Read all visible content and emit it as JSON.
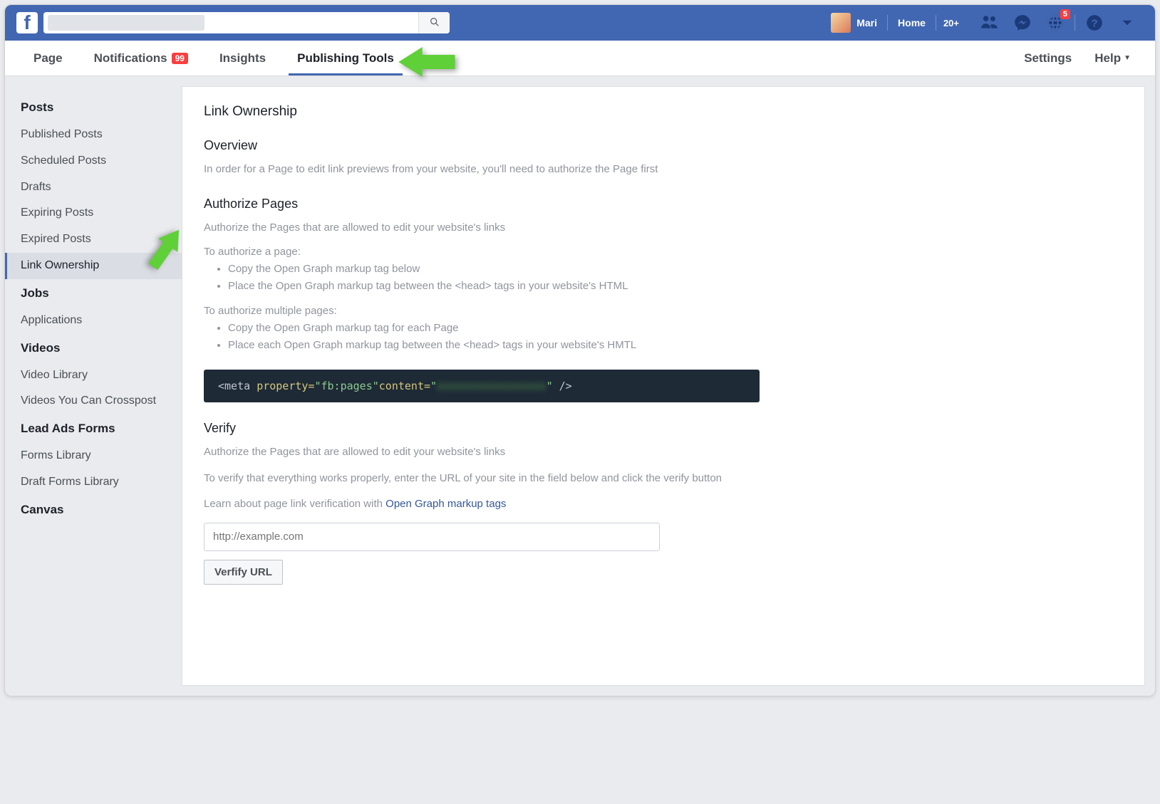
{
  "topbar": {
    "username": "Mari",
    "home_label": "Home",
    "notif_count": "20+",
    "globe_badge": "5"
  },
  "nav": {
    "tabs": [
      {
        "label": "Page"
      },
      {
        "label": "Notifications",
        "badge": "99"
      },
      {
        "label": "Insights"
      },
      {
        "label": "Publishing Tools",
        "active": true
      }
    ],
    "settings_label": "Settings",
    "help_label": "Help"
  },
  "sidebar": {
    "groups": [
      {
        "heading": "Posts",
        "items": [
          "Published Posts",
          "Scheduled Posts",
          "Drafts",
          "Expiring Posts",
          "Expired Posts",
          "Link Ownership"
        ],
        "active_index": 5
      },
      {
        "heading": "Jobs",
        "items": [
          "Applications"
        ]
      },
      {
        "heading": "Videos",
        "items": [
          "Video Library",
          "Videos You Can Crosspost"
        ]
      },
      {
        "heading": "Lead Ads Forms",
        "items": [
          "Forms Library",
          "Draft Forms Library"
        ]
      },
      {
        "heading": "Canvas",
        "items": []
      }
    ]
  },
  "main": {
    "title": "Link Ownership",
    "overview_h": "Overview",
    "overview_text": "In order for a Page to edit link previews from your website, you'll need to authorize the Page first",
    "authorize_h": "Authorize Pages",
    "authorize_text": "Authorize the Pages that are allowed to edit your website's links",
    "single_intro": "To authorize a page:",
    "single_bullets": [
      "Copy the Open Graph markup tag below",
      "Place the Open Graph markup tag between the <head> tags in your website's HTML"
    ],
    "multi_intro": "To authorize multiple pages:",
    "multi_bullets": [
      "Copy the Open Graph markup tag for each Page",
      "Place each Open Graph markup tag between the <head> tags in your website's HMTL"
    ],
    "code_prop": "\"fb:pages\"",
    "code_content": "\"",
    "code_redacted": "xxxxxxxxxxxxxxxxx",
    "code_end": "\"",
    "verify_h": "Verify",
    "verify_text1": "Authorize the Pages that are allowed to edit your website's links",
    "verify_text2": "To verify that everything works properly, enter the URL of your site in the field below and click the verify button",
    "verify_learn_prefix": "Learn about page link verification with ",
    "verify_link": "Open Graph markup tags",
    "url_placeholder": "http://example.com",
    "verify_btn": "Verfify URL"
  }
}
